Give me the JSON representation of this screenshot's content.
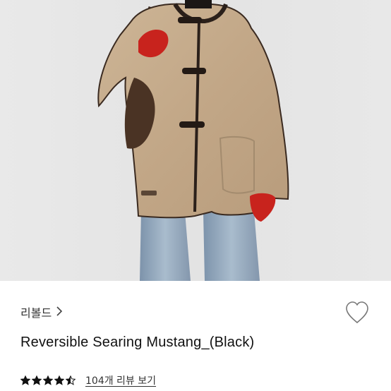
{
  "product": {
    "brand": "리볼드",
    "brand_chevron_icon": "chevron-right-icon",
    "title": "Reversible Searing Mustang_(Black)",
    "wishlist_icon": "heart-outline-icon",
    "rating": 4.5,
    "stars_max": 5,
    "review_link": "104개 리뷰 보기"
  },
  "colors": {
    "star": "#111111",
    "text": "#111111",
    "photo_background": "#e6e6e6"
  }
}
